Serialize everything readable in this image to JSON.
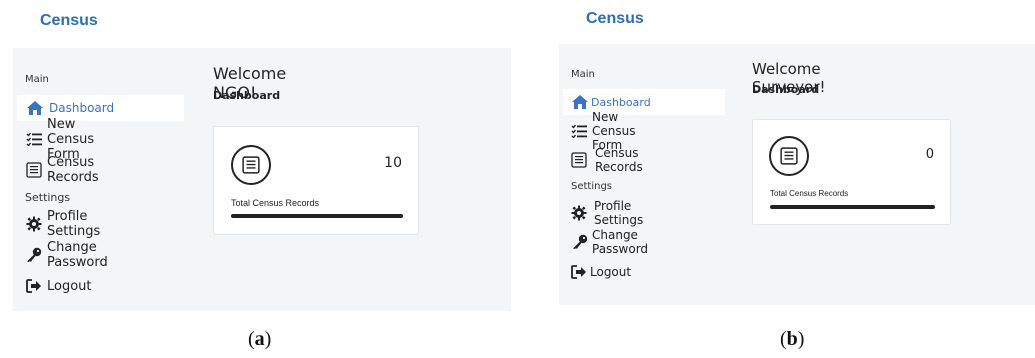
{
  "panels": [
    {
      "brand": "Census",
      "welcome": "Welcome NGO!",
      "subtitle": "Dashboard",
      "sidebar": {
        "section_main": "Main",
        "section_settings": "Settings",
        "items": [
          {
            "label": "Dashboard",
            "icon": "home-icon",
            "active": true
          },
          {
            "label": "New Census Form",
            "icon": "checklist-icon"
          },
          {
            "label": "Census Records",
            "icon": "records-icon"
          },
          {
            "label": "Profile Settings",
            "icon": "gear-icon"
          },
          {
            "label": "Change Password",
            "icon": "key-icon"
          },
          {
            "label": "Logout",
            "icon": "logout-icon"
          }
        ]
      },
      "card": {
        "count": "10",
        "label": "Total Census Records"
      },
      "caption": {
        "open": "(",
        "letter": "a",
        "close": ")"
      }
    },
    {
      "brand": "Census",
      "welcome": "Welcome Surveyor!",
      "subtitle": "Dashboard",
      "sidebar": {
        "section_main": "Main",
        "section_settings": "Settings",
        "items": [
          {
            "label": "Dashboard",
            "icon": "home-icon",
            "active": true
          },
          {
            "label": "New Census Form",
            "icon": "checklist-icon"
          },
          {
            "label": "Census Records",
            "icon": "records-icon"
          },
          {
            "label": "Profile Settings",
            "icon": "gear-icon"
          },
          {
            "label": "Change Password",
            "icon": "key-icon"
          },
          {
            "label": "Logout",
            "icon": "logout-icon"
          }
        ]
      },
      "card": {
        "count": "0",
        "label": "Total Census Records"
      },
      "caption": {
        "open": "(",
        "letter": "b",
        "close": ")"
      }
    }
  ],
  "colors": {
    "brand": "#2c6fb3",
    "active": "#3a72c4",
    "frame_bg": "#f4f5f7"
  }
}
